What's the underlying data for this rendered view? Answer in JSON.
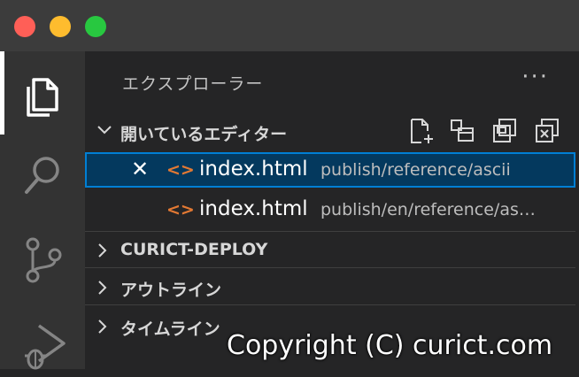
{
  "titlebar": {
    "lights": {
      "close": "#ff5f57",
      "minimize": "#febc2e",
      "zoom": "#28c840"
    }
  },
  "activity_bar": {
    "items": [
      {
        "icon": "files-icon",
        "active": true
      },
      {
        "icon": "search-icon",
        "active": false
      },
      {
        "icon": "source-control-icon",
        "active": false
      },
      {
        "icon": "run-debug-icon",
        "active": false
      }
    ]
  },
  "explorer": {
    "title": "エクスプローラー",
    "more_label": "···",
    "open_editors": {
      "label": "開いているエディター",
      "toolbar": [
        "new-untitled-file-icon",
        "toggle-vertical-layout-icon",
        "save-all-icon",
        "close-all-icon"
      ],
      "files": [
        {
          "name": "index.html",
          "path": "publish/reference/ascii",
          "icon_glyph": "<>",
          "selected": true,
          "close_glyph": "✕"
        },
        {
          "name": "index.html",
          "path": "publish/en/reference/as…",
          "icon_glyph": "<>",
          "selected": false
        }
      ]
    },
    "sections": [
      {
        "label": "CURICT-DEPLOY"
      },
      {
        "label": "アウトライン"
      },
      {
        "label": "タイムライン"
      }
    ]
  },
  "watermark": "Copyright (C) curict.com",
  "colors": {
    "activity_bar": "#333333",
    "sidebar": "#252526",
    "selection": "#04395e",
    "focus_border": "#007fd4",
    "html_icon": "#e37933"
  }
}
